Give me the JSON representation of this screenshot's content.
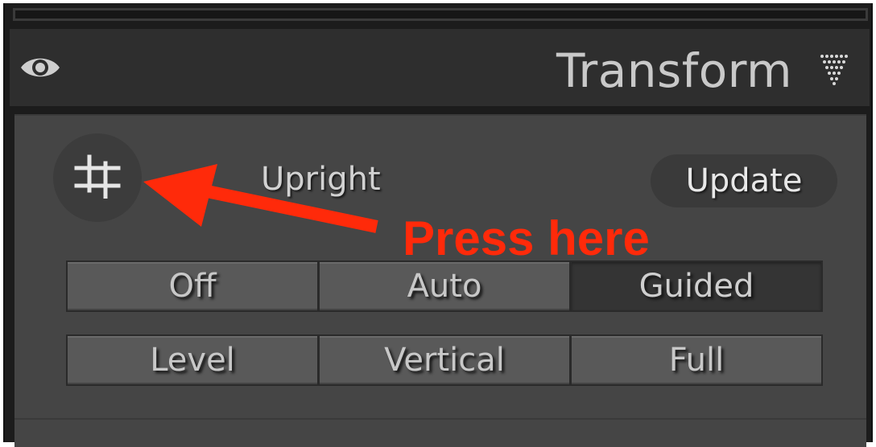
{
  "panel": {
    "title": "Transform",
    "icons": {
      "visibility": "eye-icon",
      "collapse": "triangle-collapse-icon",
      "crop": "crop-guided-icon"
    }
  },
  "upright": {
    "label": "Upright",
    "update_label": "Update",
    "mode_buttons": [
      "Off",
      "Auto",
      "Guided"
    ],
    "orientation_buttons": [
      "Level",
      "Vertical",
      "Full"
    ],
    "selected_mode": "Guided"
  },
  "annotation": {
    "text": "Press here",
    "color": "#ff2a0a"
  },
  "colors": {
    "panel_bg": "#454545",
    "header_bg": "#2e2e2e",
    "accent_annotation": "#ff2a0a"
  }
}
